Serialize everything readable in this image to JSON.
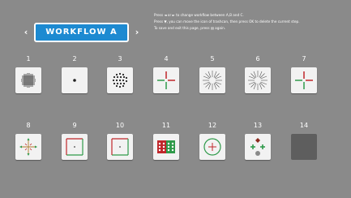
{
  "header": {
    "prev_arrow": "‹",
    "next_arrow": "›",
    "workflow_label": "WORKFLOW A"
  },
  "instructions": {
    "line1": "Press ◄ or ► to change workflow between A,B and C.",
    "line2": "Press ▼, you can move the icon of trashcan, then press OK to delete the current step.",
    "line3": "To save and exit this page,  press ▤  again."
  },
  "slots": [
    {
      "number": "1",
      "icon": "cross-grid-icon"
    },
    {
      "number": "2",
      "icon": "center-dot-icon"
    },
    {
      "number": "3",
      "icon": "dot-circle-pattern-icon"
    },
    {
      "number": "4",
      "icon": "red-green-cross-icon"
    },
    {
      "number": "5",
      "icon": "radial-burst-icon"
    },
    {
      "number": "6",
      "icon": "radial-burst-icon"
    },
    {
      "number": "7",
      "icon": "red-green-cross-icon"
    },
    {
      "number": "8",
      "icon": "four-point-cross-icon"
    },
    {
      "number": "9",
      "icon": "red-green-square-icon"
    },
    {
      "number": "10",
      "icon": "red-green-square-icon"
    },
    {
      "number": "11",
      "icon": "color-dots-grid-icon"
    },
    {
      "number": "12",
      "icon": "crosshair-circle-icon"
    },
    {
      "number": "13",
      "icon": "four-color-test-icon"
    },
    {
      "number": "14",
      "icon": "empty-slot"
    }
  ]
}
